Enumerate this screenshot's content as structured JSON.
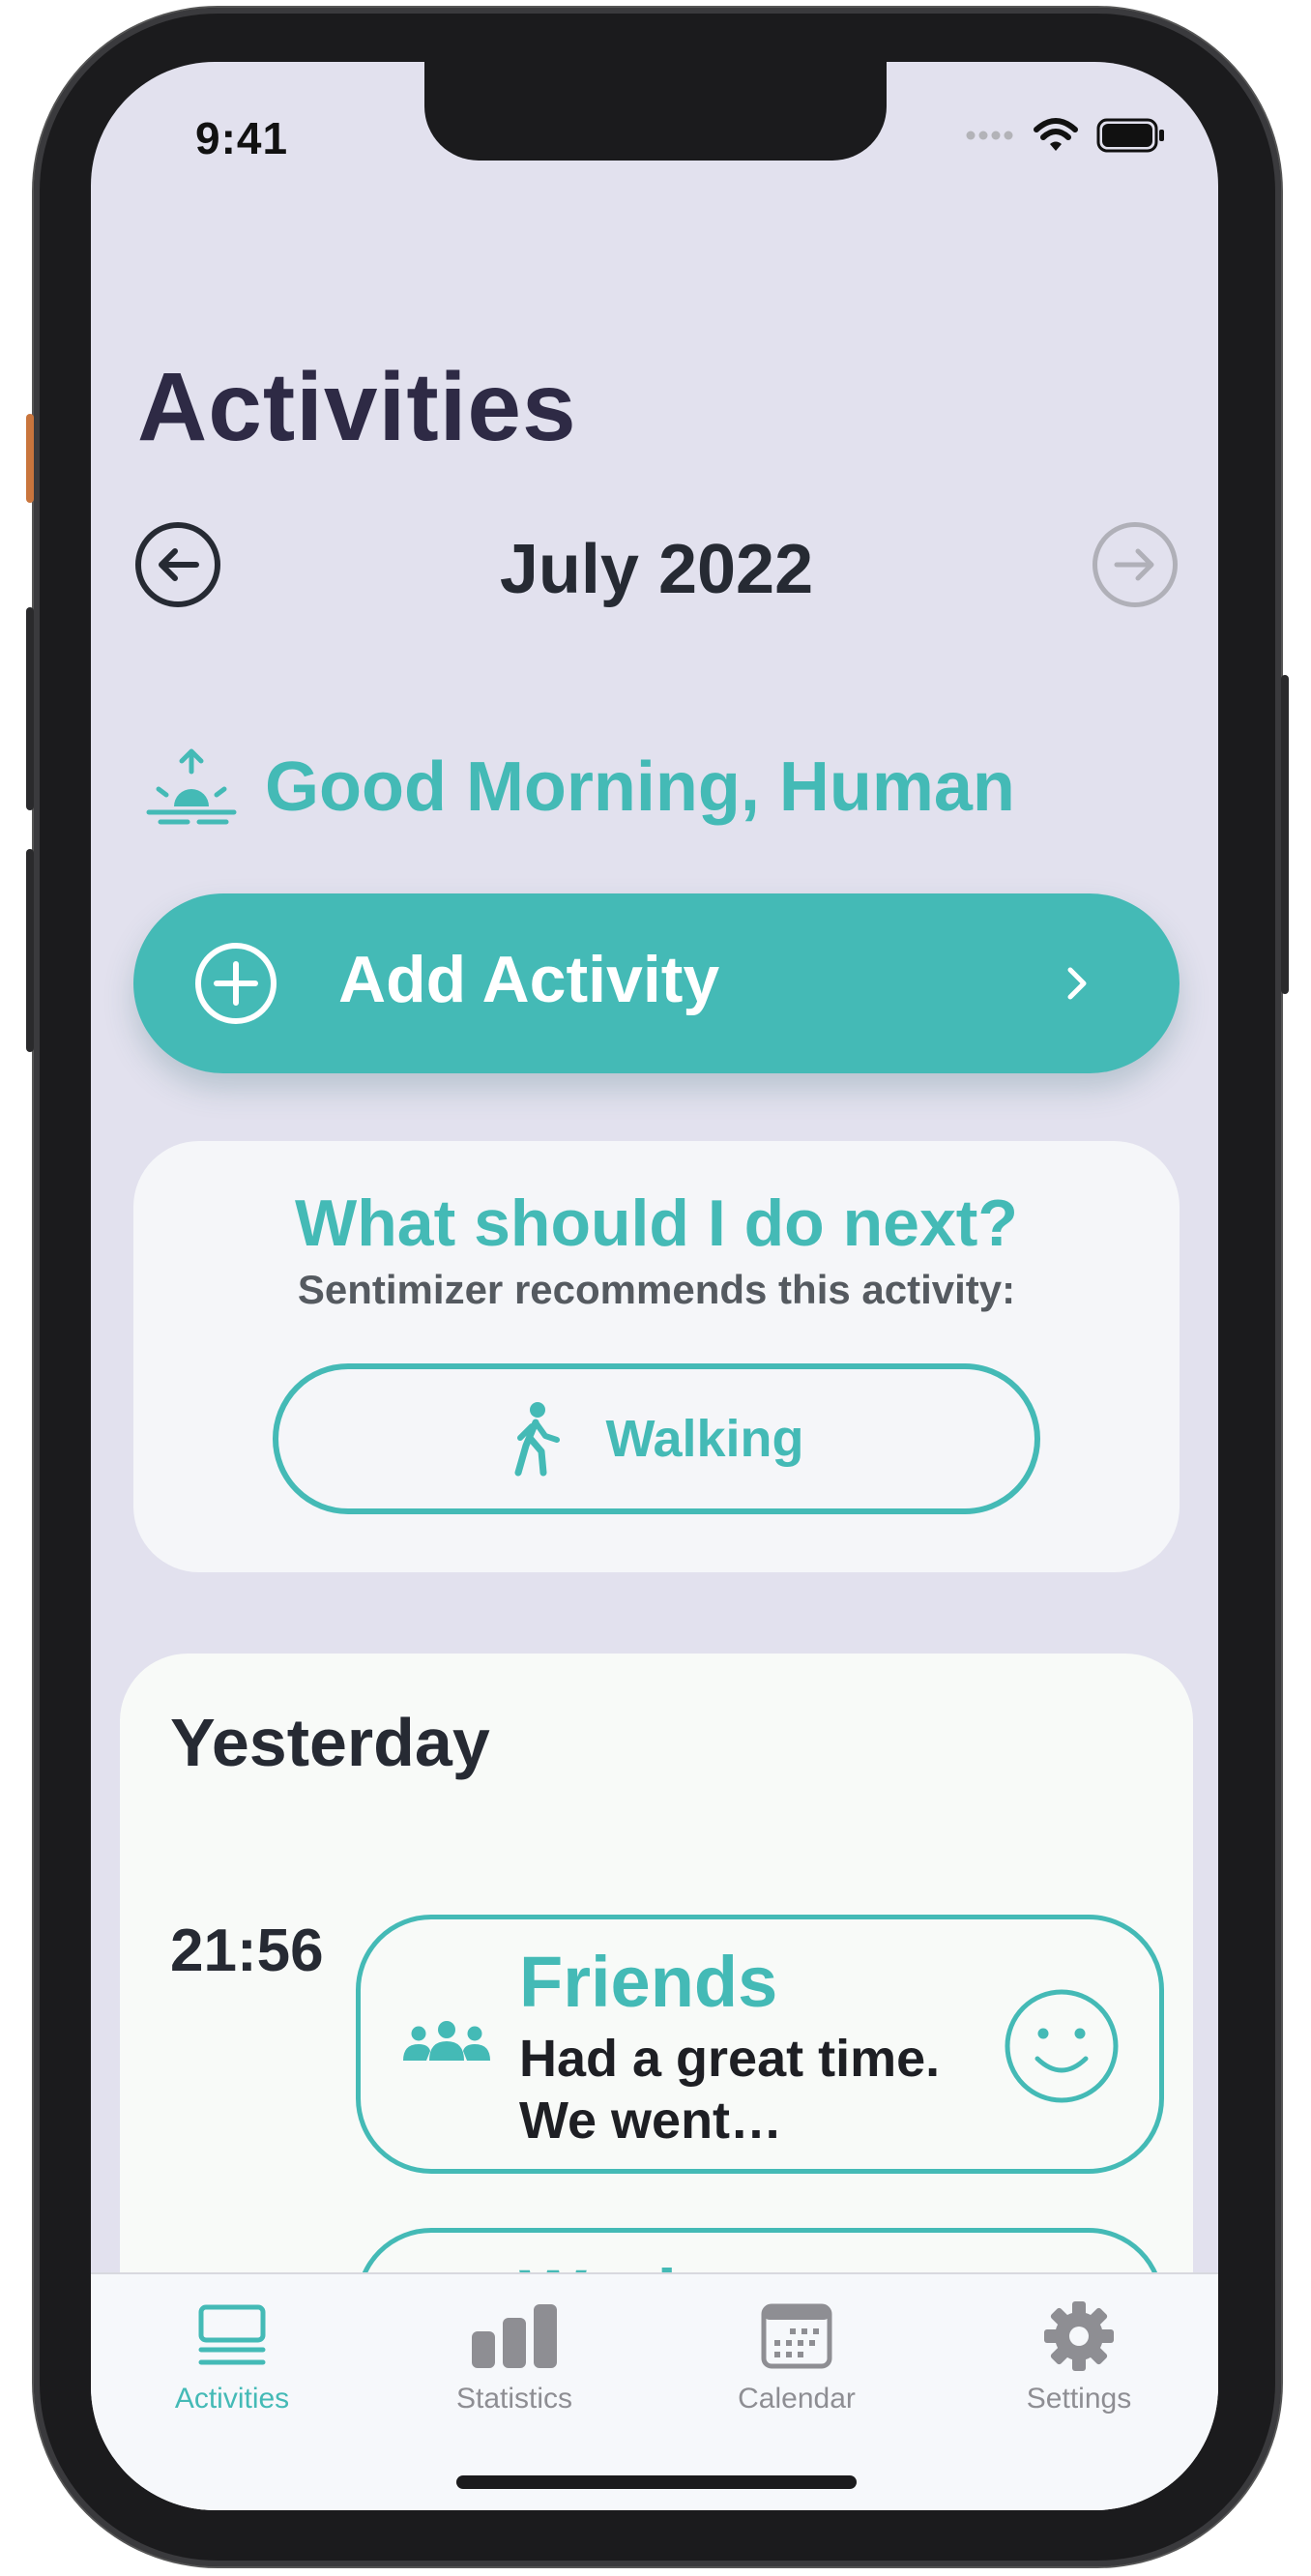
{
  "status_bar": {
    "time": "9:41"
  },
  "header": {
    "title": "Activities"
  },
  "month_nav": {
    "month": "July 2022"
  },
  "greeting": {
    "text": "Good Morning, Human",
    "icon": "sunrise-icon"
  },
  "add_activity": {
    "label": "Add Activity"
  },
  "recommendation": {
    "title": "What should I do next?",
    "subtitle": "Sentimizer recommends this activity:",
    "activity": "Walking"
  },
  "day_section": {
    "title": "Yesterday",
    "entries": [
      {
        "time": "21:56",
        "category": "Friends",
        "note": "Had a great time. We went…",
        "icon": "people-icon",
        "mood": "smile"
      },
      {
        "time": "",
        "category": "Work",
        "note": "",
        "icon": "briefcase-icon",
        "mood": "smile"
      }
    ]
  },
  "tabs": [
    {
      "label": "Activities",
      "icon": "list-icon",
      "active": true
    },
    {
      "label": "Statistics",
      "icon": "bar-chart-icon",
      "active": false
    },
    {
      "label": "Calendar",
      "icon": "calendar-icon",
      "active": false
    },
    {
      "label": "Settings",
      "icon": "gear-icon",
      "active": false
    }
  ],
  "colors": {
    "accent": "#44bab6",
    "background": "#e2e1ee",
    "title": "#2e2a45",
    "inactive_tab": "#8e8e93"
  }
}
